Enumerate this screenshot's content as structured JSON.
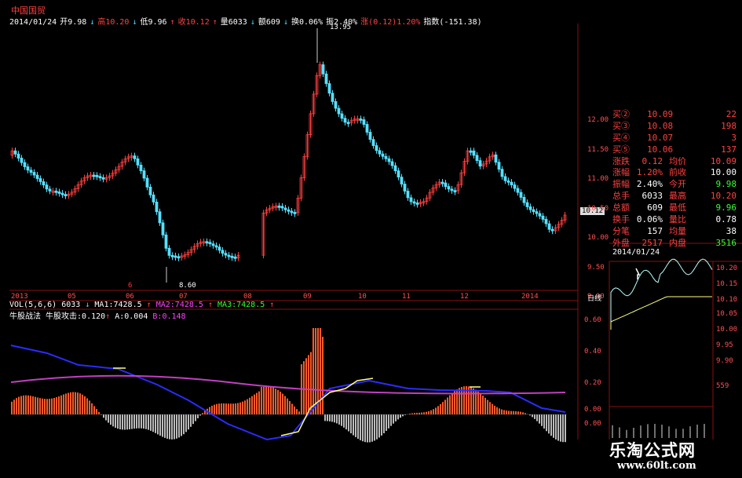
{
  "header": {
    "stock_name": "中国国贸",
    "fields": [
      {
        "text": "2014/01/24",
        "color": "wh"
      },
      {
        "text": "开9.98",
        "color": "wh"
      },
      {
        "text": "↓",
        "color": "dn"
      },
      {
        "text": "高10.20",
        "color": "up"
      },
      {
        "text": "↓",
        "color": "dn"
      },
      {
        "text": "低9.96",
        "color": "wh"
      },
      {
        "text": "↑",
        "color": "up"
      },
      {
        "text": "收10.12",
        "color": "up"
      },
      {
        "text": "↑",
        "color": "up"
      },
      {
        "text": "量6033",
        "color": "wh"
      },
      {
        "text": "↓",
        "color": "dn"
      },
      {
        "text": "额609",
        "color": "wh"
      },
      {
        "text": "↓",
        "color": "dn"
      },
      {
        "text": "换0.06%",
        "color": "wh"
      },
      {
        "text": "振2.40%",
        "color": "wh"
      },
      {
        "text": "涨(0.12)1.20%",
        "color": "up"
      },
      {
        "text": "指数(-151.38)",
        "color": "wh"
      }
    ]
  },
  "main_chart": {
    "high_marker": "13.95",
    "low_marker": "8.60",
    "current_price_tag": "10.12",
    "y_ticks": [
      "12.00",
      "11.50",
      "11.00",
      "10.50",
      "10.00",
      "9.50",
      "9.00"
    ],
    "x_ticks": [
      "2013",
      "05",
      "06",
      "07",
      "08",
      "09",
      "10",
      "11",
      "12",
      "2014"
    ],
    "period": "日线",
    "marker_6": "6"
  },
  "indicators": {
    "vol_line": {
      "label": "VOL(5,6,6) 6033",
      "ma1": "MA1:7428.5",
      "ma2": "MA2:7428.5",
      "ma3": "MA3:7428.5"
    },
    "custom_line": {
      "name": "牛股战法",
      "attack_label": "牛股攻击:0.120",
      "a_label": "A:0.004",
      "b_label": "B:0.148"
    }
  },
  "quote_panel": {
    "bids": [
      {
        "label": "买②",
        "price": "10.09",
        "vol": "22"
      },
      {
        "label": "买③",
        "price": "10.08",
        "vol": "198"
      },
      {
        "label": "买④",
        "price": "10.07",
        "vol": "3"
      },
      {
        "label": "买⑤",
        "price": "10.06",
        "vol": "137"
      }
    ],
    "stats": [
      {
        "l1": "涨跌",
        "v1": "0.12",
        "l2": "均价",
        "v2": "10.09",
        "c1": "up",
        "c2": "up"
      },
      {
        "l1": "涨幅",
        "v1": "1.20%",
        "l2": "前收",
        "v2": "10.00",
        "c1": "up",
        "c2": "wh"
      },
      {
        "l1": "振幅",
        "v1": "2.40%",
        "l2": "今开",
        "v2": "9.98",
        "c1": "wh",
        "c2": "gr"
      },
      {
        "l1": "总手",
        "v1": "6033",
        "l2": "最高",
        "v2": "10.20",
        "c1": "wh",
        "c2": "up"
      },
      {
        "l1": "总额",
        "v1": "609",
        "l2": "最低",
        "v2": "9.96",
        "c1": "wh",
        "c2": "gr"
      },
      {
        "l1": "换手",
        "v1": "0.06%",
        "l2": "量比",
        "v2": "0.78",
        "c1": "wh",
        "c2": "wh"
      },
      {
        "l1": "分笔",
        "v1": "157",
        "l2": "均量",
        "v2": "38",
        "c1": "wh",
        "c2": "wh"
      },
      {
        "l1": "外盘",
        "v1": "2517",
        "l2": "内盘",
        "v2": "3516",
        "c1": "up",
        "c2": "gr"
      }
    ],
    "date": "2014/01/24",
    "mini_y_left": [
      "0.60",
      "0.40",
      "0.20",
      "0.00",
      "0.00"
    ],
    "mini_y_right": [
      "10.20",
      "10.15",
      "10.10",
      "10.05",
      "10.00",
      "9.95",
      "9.90",
      "559"
    ]
  },
  "watermark": {
    "line1": "乐淘公式网",
    "line2": "www.60lt.com"
  },
  "colors": {
    "up": "#ff4040",
    "down": "#57e0ff",
    "grid": "#8a1010",
    "ma": "#c040c0"
  }
}
